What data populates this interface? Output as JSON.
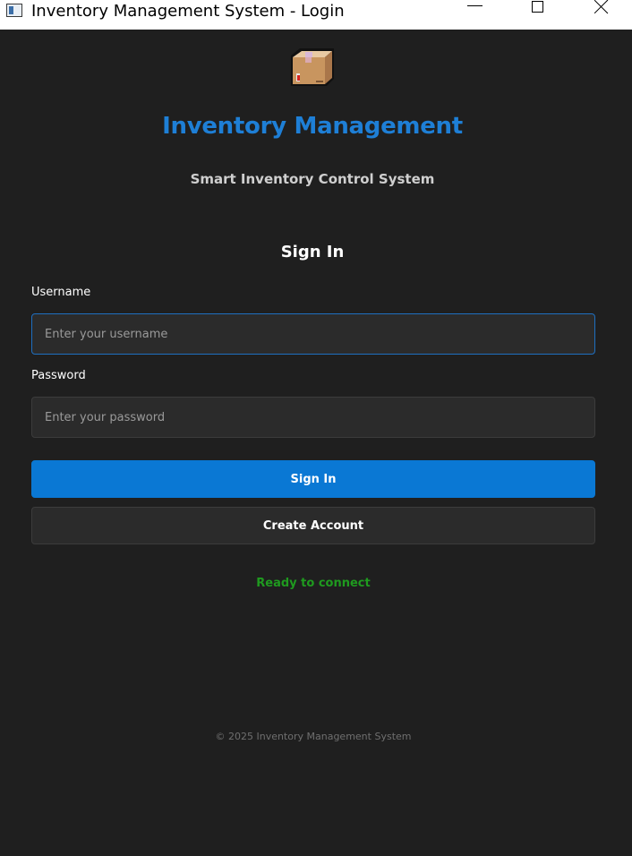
{
  "window": {
    "title": "Inventory Management System - Login",
    "controls": {
      "minimize": "minimize-icon",
      "maximize": "maximize-icon",
      "close": "close-icon"
    }
  },
  "header": {
    "logo_icon": "package-box-icon",
    "title": "Inventory Management",
    "subtitle": "Smart Inventory Control System"
  },
  "form": {
    "heading": "Sign In",
    "username": {
      "label": "Username",
      "placeholder": "Enter your username",
      "value": ""
    },
    "password": {
      "label": "Password",
      "placeholder": "Enter your password",
      "value": ""
    },
    "signin_label": "Sign In",
    "create_account_label": "Create Account"
  },
  "status": {
    "text": "Ready to connect",
    "color": "#1f9a1f"
  },
  "footer": {
    "text": "© 2025 Inventory Management System"
  },
  "colors": {
    "background": "#1f1f1f",
    "accent": "#0a78d4",
    "title": "#1e7fd6",
    "input_bg": "#2b2b2b",
    "focus_border": "#1e6fc0"
  }
}
